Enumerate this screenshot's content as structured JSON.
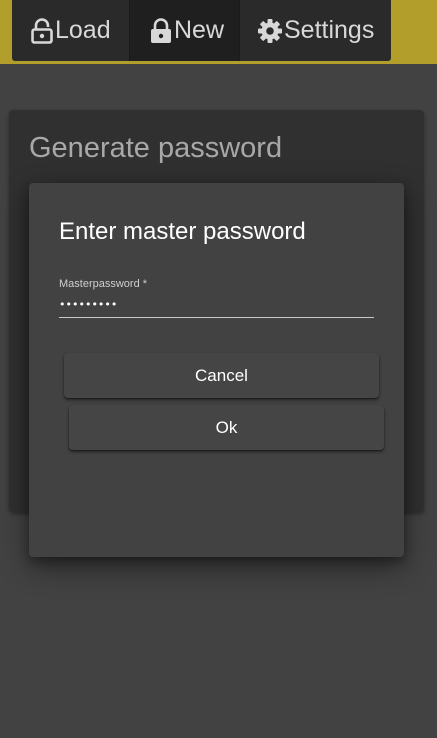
{
  "nav": {
    "items": [
      {
        "label": "Load",
        "icon": "lock-open-icon"
      },
      {
        "label": "New",
        "icon": "lock-icon"
      },
      {
        "label": "Settings",
        "icon": "gear-icon"
      }
    ]
  },
  "card": {
    "title": "Generate password"
  },
  "dialog": {
    "title": "Enter master password",
    "field_label": "Masterpassword *",
    "field_value": "•••••••••",
    "cancel_label": "Cancel",
    "ok_label": "Ok"
  },
  "colors": {
    "accent": "#b29e2a",
    "nav_background": "#2a2a2a",
    "page_background": "#424242",
    "card_background": "#303030"
  }
}
